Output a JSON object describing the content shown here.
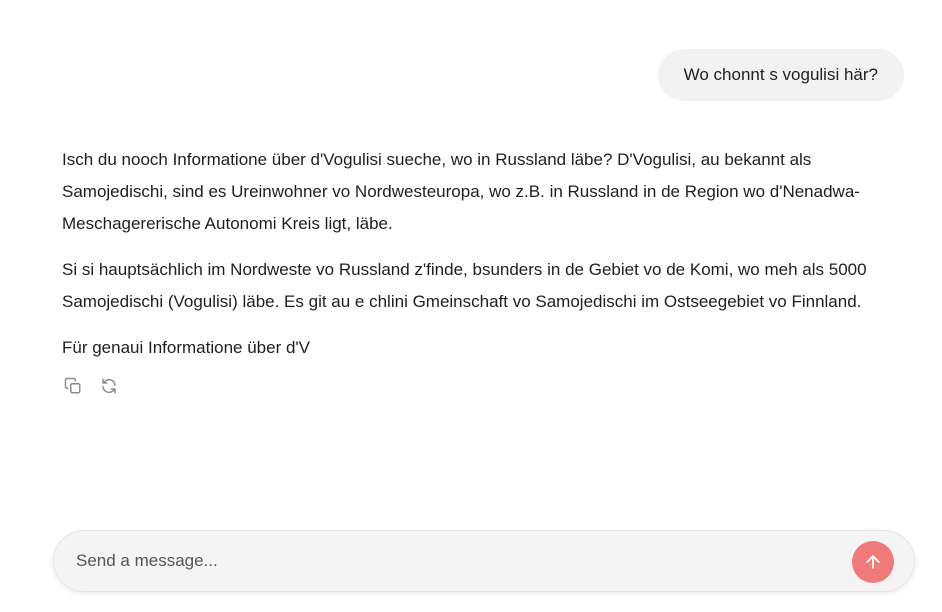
{
  "conversation": {
    "user_message": "Wo chonnt s vogulisi här?",
    "assistant_paragraphs": [
      "Isch du nooch Informatione über d'Vogulisi sueche, wo in Russland läbe? D'Vogulisi, au bekannt als Samojedischi, sind es Ureinwohner vo Nordwesteuropa, wo z.B. in Russland in de Region wo d'Nenadwa-Meschagererische Autonomi Kreis ligt, läbe.",
      "Si si hauptsächlich im Nordweste vo Russland z'finde, bsunders in de Gebiet vo de Komi, wo meh als 5000 Samojedischi (Vogulisi) läbe. Es git au e chlini Gmeinschaft vo Samojedischi im Ostseegebiet vo Finnland.",
      "Für genaui Informatione über d'V"
    ],
    "actions": {
      "copy_icon": "copy-icon",
      "regenerate_icon": "refresh-icon"
    }
  },
  "composer": {
    "placeholder": "Send a message...",
    "value": "",
    "send_icon": "arrow-up-icon"
  },
  "colors": {
    "user_bubble_bg": "#f2f2f2",
    "composer_bg": "#f4f4f4",
    "send_button": "#f07a7a",
    "icon_gray": "#8a8a8a"
  }
}
